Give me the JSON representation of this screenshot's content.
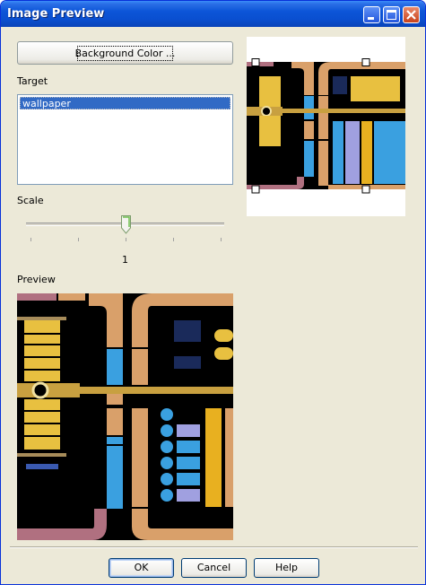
{
  "window": {
    "title": "Image Preview"
  },
  "controls": {
    "minimize_icon": "minimize-icon",
    "maximize_icon": "maximize-icon",
    "close_icon": "close-icon"
  },
  "background_button": {
    "label": "Background Color ..."
  },
  "target": {
    "label": "Target",
    "items": [
      "wallpaper"
    ],
    "selected": "wallpaper"
  },
  "scale": {
    "label": "Scale",
    "value": "1",
    "position_fraction": 0.5
  },
  "preview": {
    "label": "Preview"
  },
  "buttons": {
    "ok": "OK",
    "cancel": "Cancel",
    "help": "Help"
  },
  "colors": {
    "title_blue": "#0a4fd0",
    "lcars_tan": "#d9a06a",
    "lcars_blue": "#3aa0e0",
    "lcars_gold": "#e8c040",
    "lcars_lavender": "#a0a0e0",
    "lcars_mauve": "#b07080"
  }
}
